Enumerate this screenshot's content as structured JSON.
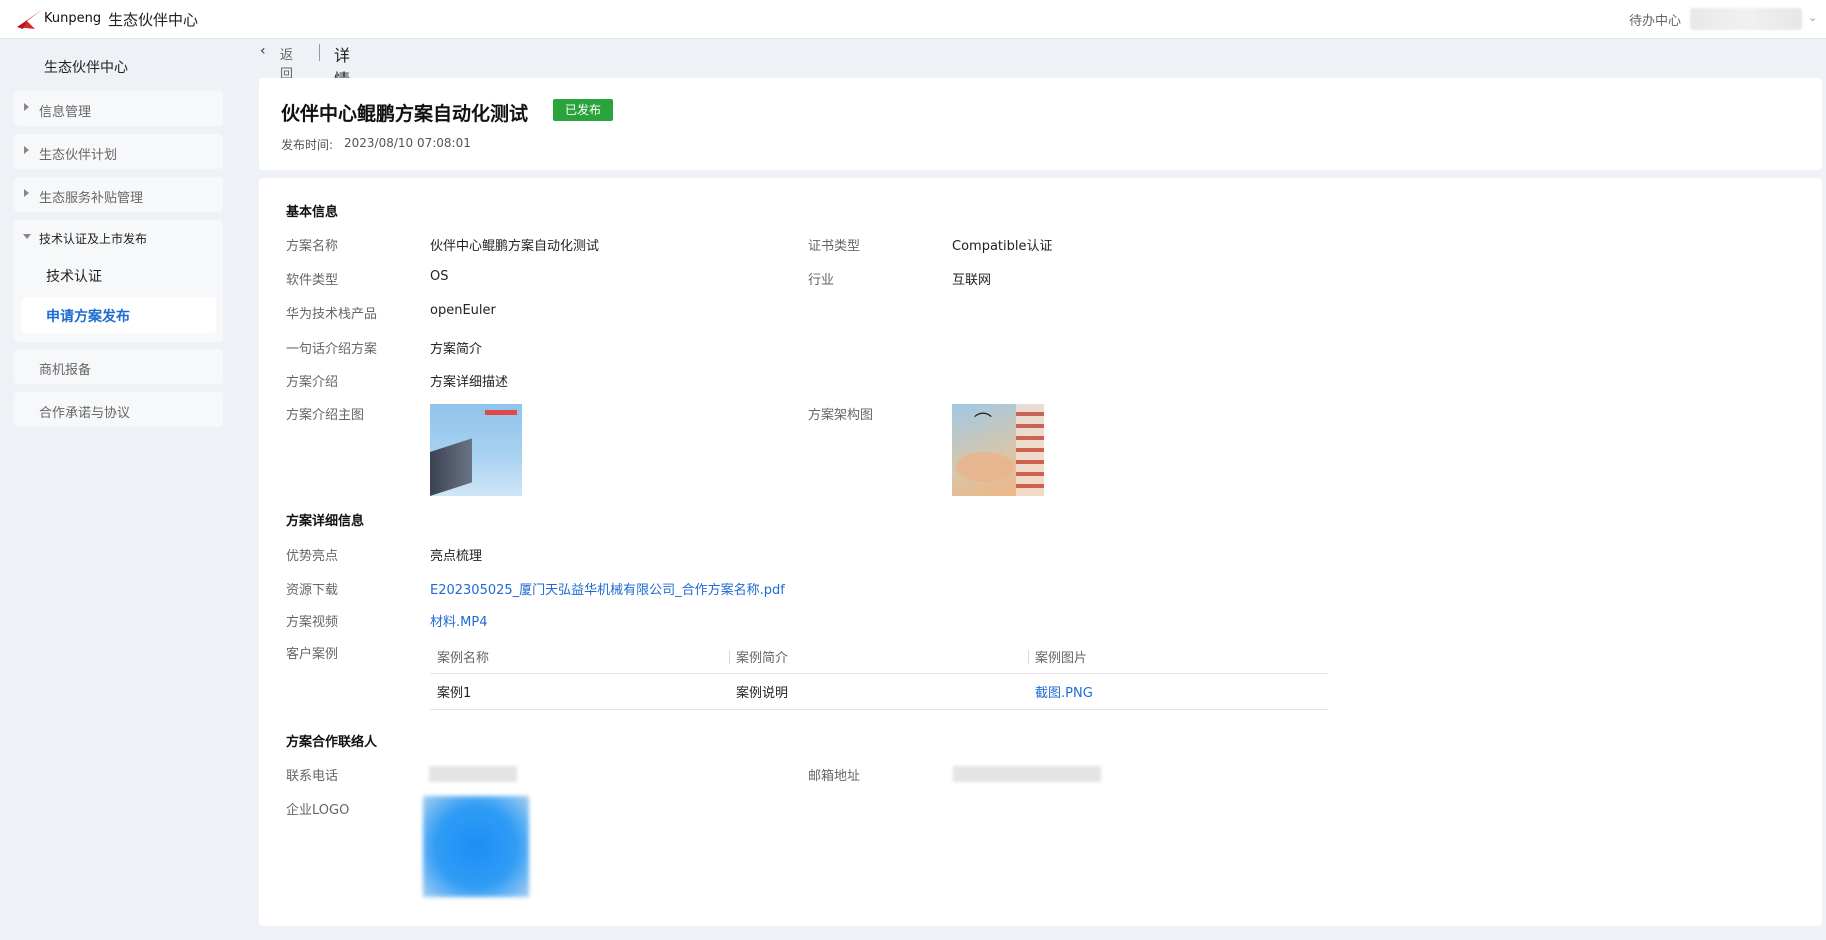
{
  "header": {
    "logo_text": "Kunpeng",
    "app_title": "生态伙伴中心",
    "todo_label": "待办中心"
  },
  "sidebar": {
    "title": "生态伙伴中心",
    "items": [
      {
        "label": "信息管理"
      },
      {
        "label": "生态伙伴计划"
      },
      {
        "label": "生态服务补贴管理"
      },
      {
        "label": "技术认证及上市发布",
        "children": [
          {
            "label": "技术认证"
          },
          {
            "label": "申请方案发布",
            "active": true
          }
        ]
      },
      {
        "label": "商机报备"
      },
      {
        "label": "合作承诺与协议"
      }
    ]
  },
  "breadcrumb": {
    "back_label": "返回",
    "current": "详情"
  },
  "detail": {
    "title": "伙伴中心鲲鹏方案自动化测试",
    "status": "已发布",
    "status_color": "#2ba33c",
    "publish_time_label": "发布时间:",
    "publish_time": "2023/08/10 07:08:01"
  },
  "basic_info": {
    "section_title": "基本信息",
    "solution_name_label": "方案名称",
    "solution_name": "伙伴中心鲲鹏方案自动化测试",
    "cert_type_label": "证书类型",
    "cert_type": "Compatible认证",
    "software_type_label": "软件类型",
    "software_type": "OS",
    "industry_label": "行业",
    "industry": "互联网",
    "tech_stack_label": "华为技术栈产品",
    "tech_stack": "openEuler",
    "one_line_label": "一句话介绍方案",
    "one_line": "方案简介",
    "intro_label": "方案介绍",
    "intro": "方案详细描述",
    "main_image_label": "方案介绍主图",
    "arch_image_label": "方案架构图"
  },
  "detail_info": {
    "section_title": "方案详细信息",
    "highlights_label": "优势亮点",
    "highlights": "亮点梳理",
    "download_label": "资源下载",
    "download_file": "E202305025_厦门天弘益华机械有限公司_合作方案名称.pdf",
    "video_label": "方案视频",
    "video_file": "材料.MP4",
    "cases_label": "客户案例",
    "case_columns": [
      "案例名称",
      "案例简介",
      "案例图片"
    ],
    "cases": [
      {
        "name": "案例1",
        "desc": "案例说明",
        "image": "截图.PNG"
      }
    ]
  },
  "contact": {
    "section_title": "方案合作联络人",
    "phone_label": "联系电话",
    "email_label": "邮箱地址",
    "logo_label": "企业LOGO"
  },
  "colors": {
    "link": "#1f6bd1",
    "background": "#eef1f6"
  }
}
